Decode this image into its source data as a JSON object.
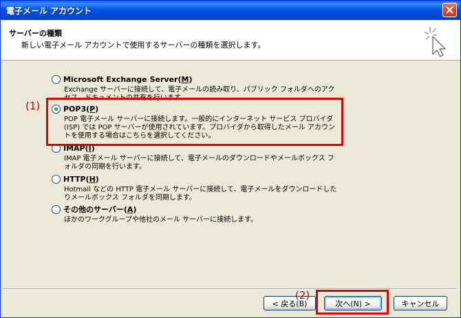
{
  "window": {
    "title": "電子メール アカウント",
    "close_glyph": "✕"
  },
  "header": {
    "title": "サーバーの種類",
    "subtitle": "新しい電子メール アカウントで使用するサーバーの種類を選択します。",
    "icon": "wizard-wand-icon"
  },
  "options": [
    {
      "label": "Microsoft Exchange Server",
      "mnemonic": "M",
      "desc": "Exchange サーバーに接続して、電子メールの読み取り、パブリック フォルダへのアクセス、ドキュメントの共有を行います。",
      "checked": false
    },
    {
      "label": "POP3",
      "mnemonic": "P",
      "desc": "POP 電子メール サーバーに接続します。一般的にインターネット サービス プロバイダ (ISP) では POP サーバーが使用されています。プロバイダから取得したメール アカウントを使用する場合はこちらを選択してください。",
      "checked": true
    },
    {
      "label": "IMAP",
      "mnemonic": "I",
      "desc": "IMAP 電子メール サーバーに接続して、電子メールのダウンロードやメールボックス フォルダの同期を行います。",
      "checked": false
    },
    {
      "label": "HTTP",
      "mnemonic": "H",
      "desc": "Hotmail などの HTTP 電子メール サーバーに接続して、電子メールをダウンロードしたりメールボックス フォルダを同期します。",
      "checked": false
    },
    {
      "label": "その他のサーバー",
      "mnemonic": "A",
      "desc": "ほかのワークグループや他社のメール サーバーに接続します。",
      "checked": false
    }
  ],
  "annotations": {
    "callout1": "(1)",
    "callout2": "(2)",
    "highlight_color": "#e00000"
  },
  "buttons": {
    "back": "< 戻る(B)",
    "next": "次へ(N) >",
    "cancel": "キャンセル"
  },
  "colors": {
    "titlebar": "#0054e3",
    "dialog_bg": "#ece9d8",
    "radio_check": "#2fa82f"
  }
}
